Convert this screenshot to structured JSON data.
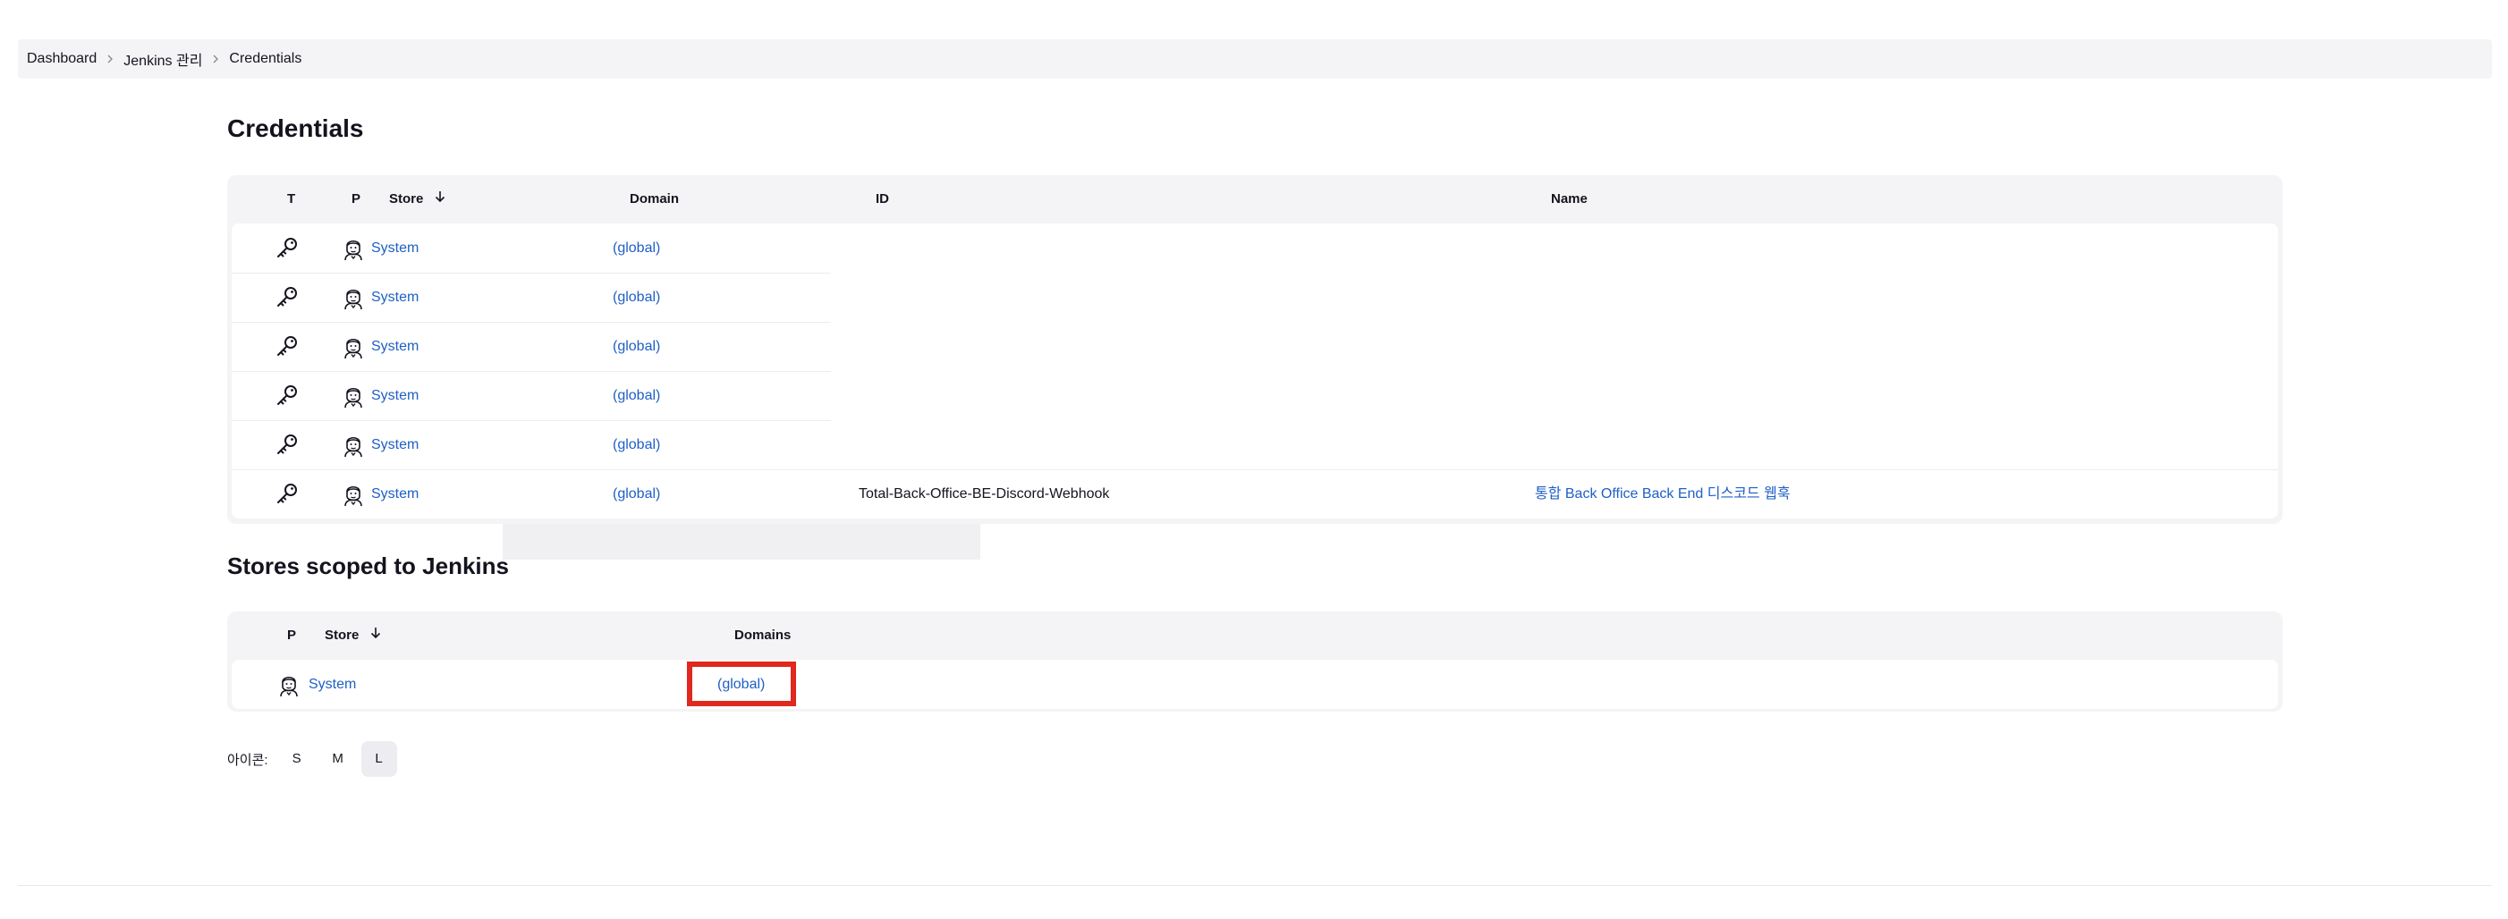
{
  "breadcrumb": {
    "items": [
      "Dashboard",
      "Jenkins 관리",
      "Credentials"
    ]
  },
  "credentials": {
    "title": "Credentials",
    "columns": {
      "t": "T",
      "p": "P",
      "store": "Store",
      "domain": "Domain",
      "id": "ID",
      "name": "Name"
    },
    "rows": [
      {
        "store": "System",
        "domain": "(global)",
        "id": "",
        "name": ""
      },
      {
        "store": "System",
        "domain": "(global)",
        "id": "",
        "name": ""
      },
      {
        "store": "System",
        "domain": "(global)",
        "id": "",
        "name": ""
      },
      {
        "store": "System",
        "domain": "(global)",
        "id": "",
        "name": ""
      },
      {
        "store": "System",
        "domain": "(global)",
        "id": "",
        "name": ""
      },
      {
        "store": "System",
        "domain": "(global)",
        "id": "Total-Back-Office-BE-Discord-Webhook",
        "name": "통합 Back Office Back End 디스코드 웹훅"
      }
    ]
  },
  "stores": {
    "title": "Stores scoped to Jenkins",
    "columns": {
      "p": "P",
      "store": "Store",
      "domains": "Domains"
    },
    "rows": [
      {
        "store": "System",
        "domains": "(global)"
      }
    ]
  },
  "icon_size": {
    "label": "아이콘:",
    "options": [
      "S",
      "M",
      "L"
    ],
    "selected": "L"
  },
  "colors": {
    "link": "#1f5fc7",
    "highlight": "#e0281e",
    "table_bg": "#f4f4f6"
  },
  "icons": {
    "type_icon": "key-icon",
    "provider_icon": "jenkins-butler-icon",
    "sort_icon": "arrow-down-icon",
    "breadcrumb_separator": "chevron-right-icon"
  }
}
